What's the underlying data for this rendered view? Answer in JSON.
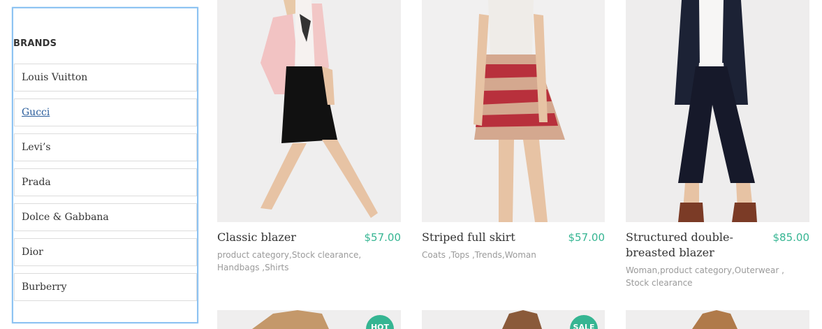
{
  "sidebar": {
    "title": "BRANDS",
    "brands": [
      {
        "label": "Louis Vuitton"
      },
      {
        "label": "Gucci"
      },
      {
        "label": "Levi’s"
      },
      {
        "label": "Prada"
      },
      {
        "label": "Dolce & Gabbana"
      },
      {
        "label": "Dior"
      },
      {
        "label": "Burberry"
      }
    ]
  },
  "products": [
    {
      "name": "Classic blazer",
      "price": "$57.00",
      "categories": "product category,Stock clearance, Handbags ,Shirts"
    },
    {
      "name": "Striped full skirt",
      "price": "$57.00",
      "categories": "Coats ,Tops ,Trends,Woman"
    },
    {
      "name": "Structured double-breasted blazer",
      "price": "$85.00",
      "categories": "Woman,product category,Outerwear , Stock clearance"
    }
  ],
  "next_row": {
    "badges": [
      "HOT",
      "SALE"
    ]
  },
  "colors": {
    "accent": "#35b592",
    "sidebar_border": "#8ec3f2",
    "link": "#2a5d9c"
  }
}
